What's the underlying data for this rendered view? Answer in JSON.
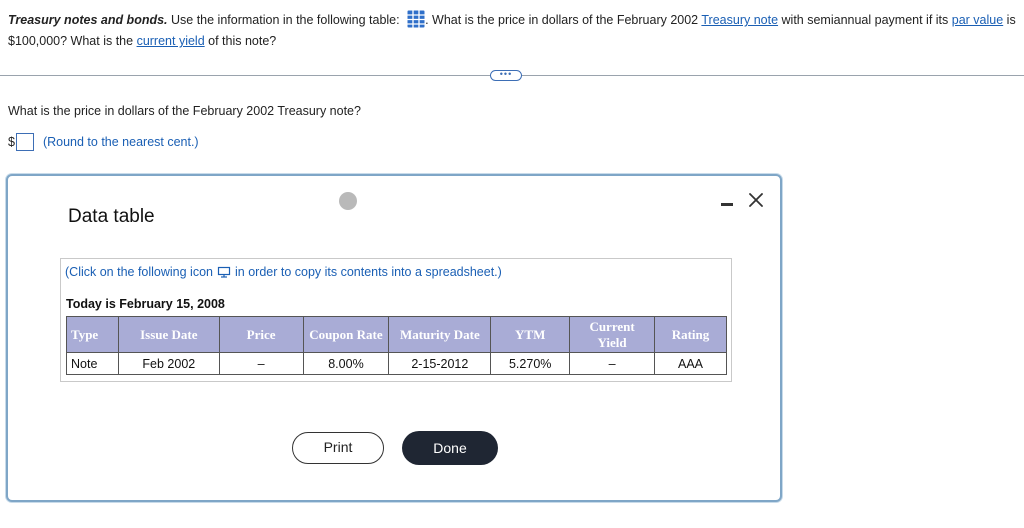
{
  "question": {
    "title": "Treasury notes and bonds.",
    "text1": " Use the information in the following table: ",
    "text2": ". What is the price in dollars of the February 2002 ",
    "link_treasury_note": "Treasury note",
    "text3": " with semiannual payment if its ",
    "link_par_value": "par value",
    "text4": " is $100,000? What is the ",
    "link_current_yield": "current yield",
    "text5": " of this note?"
  },
  "more_button": "•••",
  "sub_question": "What is the price in dollars of the February 2002 Treasury note?",
  "answer": {
    "currency": "$",
    "value": "",
    "note": "(Round to the nearest cent.)"
  },
  "modal": {
    "title": "Data table",
    "copy_note_prefix": "(Click on the following icon",
    "copy_note_suffix": "in order to copy its contents into a spreadsheet.)",
    "today": "Today is February 15, 2008",
    "table": {
      "headers": [
        "Type",
        "Issue Date",
        "Price",
        "Coupon Rate",
        "Maturity Date",
        "YTM",
        "Current Yield",
        "Rating"
      ],
      "rows": [
        [
          "Note",
          "Feb 2002",
          "–",
          "8.00%",
          "2-15-2012",
          "5.270%",
          "–",
          "AAA"
        ]
      ]
    },
    "print_label": "Print",
    "done_label": "Done"
  },
  "icons": {
    "table": "table-grid-icon",
    "copy": "copy-icon",
    "minimize": "minimize-icon",
    "close": "close-icon"
  },
  "colors": {
    "link": "#1a5fb4",
    "header_bg": "#a9acd6",
    "done_bg": "#1f2633",
    "modal_border": "#7fa6c7"
  }
}
